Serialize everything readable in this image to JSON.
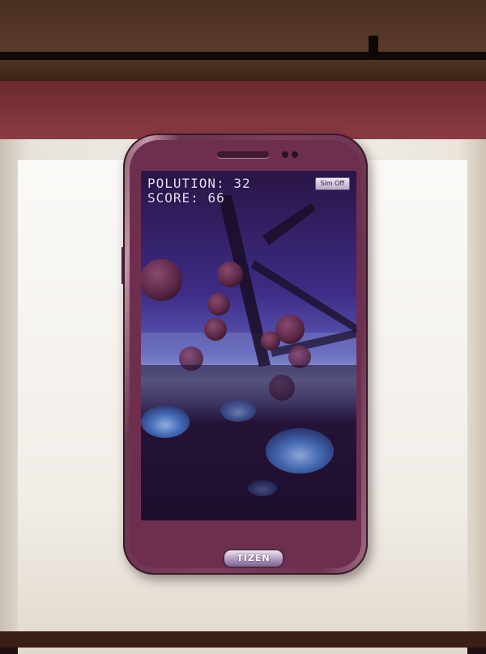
{
  "hud": {
    "pollution_label": "POLUTION:",
    "pollution_value": "32",
    "score_label": "SCORE:",
    "score_value": "66",
    "sim_toggle_label": "Sim Off"
  },
  "device": {
    "home_button_label": "TIZEN"
  },
  "colors": {
    "screen_sky_top": "#2a1546",
    "screen_sky_mid": "#4a3aa0",
    "horizon": "#9aa6dc",
    "ground": "#1e0f2e",
    "bubble": "#5a2746",
    "jellyfish": "#4a78c8",
    "hud_text": "#e6ddf6"
  }
}
